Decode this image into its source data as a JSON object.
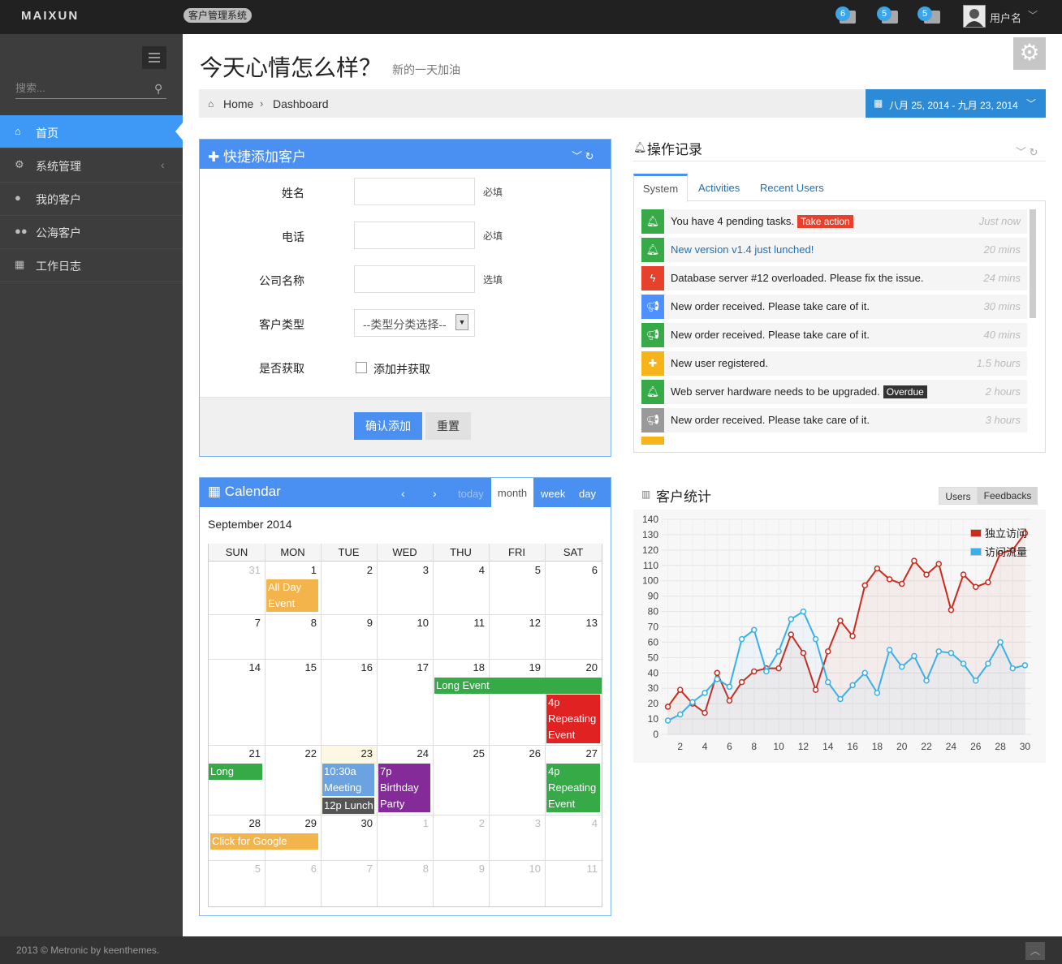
{
  "topbar": {
    "logo": "MAIXUN",
    "system_badge": "客户管理系统",
    "notifications_count": "6",
    "inbox_count": "5",
    "tasks_count": "5",
    "username": "用户名"
  },
  "sidebar": {
    "search_placeholder": "搜索...",
    "items": [
      {
        "label": "首页",
        "icon": "home-icon",
        "active": true
      },
      {
        "label": "系统管理",
        "icon": "cogs-icon"
      },
      {
        "label": "我的客户",
        "icon": "user-icon"
      },
      {
        "label": "公海客户",
        "icon": "group-icon"
      },
      {
        "label": "工作日志",
        "icon": "table-icon"
      }
    ]
  },
  "header": {
    "title": "今天心情怎么样？",
    "subtitle": "新的一天加油",
    "breadcrumb": [
      "Home",
      "Dashboard"
    ],
    "date_range": "八月 25, 2014 - 九月 23, 2014"
  },
  "quick_add": {
    "title": "快捷添加客户",
    "fields": [
      {
        "label": "姓名",
        "hint": "必填"
      },
      {
        "label": "电话",
        "hint": "必填"
      },
      {
        "label": "公司名称",
        "hint": "选填"
      },
      {
        "label": "客户类型",
        "select_value": "--类型分类选择--"
      },
      {
        "label": "是否获取",
        "checkbox_label": "添加并获取"
      }
    ],
    "submit": "确认添加",
    "reset": "重置"
  },
  "activity": {
    "title": "操作记录",
    "tabs": [
      "System",
      "Activities",
      "Recent Users"
    ],
    "feeds": [
      {
        "text": "You have 4 pending tasks.",
        "label": "Take action",
        "label_color": "#e5412d",
        "time": "Just now",
        "color": "#35aa47",
        "icon": "bell-icon",
        "link": false
      },
      {
        "text": "New version v1.4 just lunched!",
        "time": "20 mins",
        "color": "#35aa47",
        "icon": "bell-icon",
        "link": true
      },
      {
        "text": "Database server #12 overloaded. Please fix the issue.",
        "time": "24 mins",
        "color": "#e5412d",
        "icon": "bolt-icon",
        "link": false
      },
      {
        "text": "New order received. Please take care of it.",
        "time": "30 mins",
        "color": "#4d90fe",
        "icon": "bullhorn-icon",
        "link": false
      },
      {
        "text": "New order received. Please take care of it.",
        "time": "40 mins",
        "color": "#35aa47",
        "icon": "bullhorn-icon",
        "link": false
      },
      {
        "text": "New user registered.",
        "time": "1.5 hours",
        "color": "#f4b41a",
        "icon": "plus-icon",
        "link": false
      },
      {
        "text": "Web server hardware needs to be upgraded.",
        "label": "Overdue",
        "label_color": "#333333",
        "time": "2 hours",
        "color": "#35aa47",
        "icon": "bell-icon",
        "link": false
      },
      {
        "text": "New order received. Please take care of it.",
        "time": "3 hours",
        "color": "#999999",
        "icon": "bullhorn-icon",
        "link": false
      }
    ]
  },
  "calendar": {
    "title": "Calendar",
    "buttons": {
      "today": "today",
      "month": "month",
      "week": "week",
      "day": "day"
    },
    "month_title": "September 2014",
    "weekdays": [
      "SUN",
      "MON",
      "TUE",
      "WED",
      "THU",
      "FRI",
      "SAT"
    ],
    "weeks": [
      [
        "31",
        "1",
        "2",
        "3",
        "4",
        "5",
        "6"
      ],
      [
        "7",
        "8",
        "9",
        "10",
        "11",
        "12",
        "13"
      ],
      [
        "14",
        "15",
        "16",
        "17",
        "18",
        "19",
        "20"
      ],
      [
        "21",
        "22",
        "23",
        "24",
        "25",
        "26",
        "27"
      ],
      [
        "28",
        "29",
        "30",
        "1",
        "2",
        "3",
        "4"
      ],
      [
        "5",
        "6",
        "7",
        "8",
        "9",
        "10",
        "11"
      ]
    ],
    "events": [
      {
        "title": "All Day Event",
        "color": "#f4b44c"
      },
      {
        "title": "Long Event",
        "color": "#35aa47"
      },
      {
        "title": "4p Repeating Event",
        "color": "#e02222"
      },
      {
        "title": "Long Event",
        "color": "#35aa47"
      },
      {
        "title": "10:30a Meeting",
        "color": "#6aa3e0"
      },
      {
        "title": "12p Lunch",
        "color": "#555555"
      },
      {
        "title": "7p Birthday Party",
        "color": "#852b99"
      },
      {
        "title": "4p Repeating Event",
        "color": "#35aa47"
      },
      {
        "title": "Click for Google",
        "color": "#f4b44c"
      }
    ]
  },
  "stats": {
    "title": "客户统计",
    "toggle": [
      "Users",
      "Feedbacks"
    ]
  },
  "chart_data": {
    "type": "line",
    "title": "客户统计",
    "x": [
      1,
      2,
      3,
      4,
      5,
      6,
      7,
      8,
      9,
      10,
      11,
      12,
      13,
      14,
      15,
      16,
      17,
      18,
      19,
      20,
      21,
      22,
      23,
      24,
      25,
      26,
      27,
      28,
      29,
      30
    ],
    "xticks": [
      2,
      4,
      6,
      8,
      10,
      12,
      14,
      16,
      18,
      20,
      22,
      24,
      26,
      28,
      30
    ],
    "ylim": [
      0,
      140
    ],
    "yticks": [
      0,
      10,
      20,
      30,
      40,
      50,
      60,
      70,
      80,
      90,
      100,
      110,
      120,
      130,
      140
    ],
    "series": [
      {
        "name": "独立访问",
        "color": "#cb2a1d",
        "values": [
          18,
          29,
          20,
          14,
          40,
          22,
          34,
          41,
          43,
          43,
          65,
          53,
          29,
          54,
          74,
          64,
          97,
          108,
          101,
          98,
          113,
          104,
          111,
          81,
          104,
          96,
          99,
          118,
          120,
          131
        ]
      },
      {
        "name": "访问流量",
        "color": "#3ab0e8",
        "values": [
          9,
          13,
          21,
          27,
          36,
          31,
          62,
          68,
          41,
          54,
          75,
          80,
          62,
          34,
          23,
          32,
          40,
          27,
          55,
          44,
          51,
          35,
          54,
          53,
          46,
          35,
          46,
          60,
          43,
          45
        ]
      }
    ],
    "grid": true,
    "legend": "top-right"
  },
  "footer": {
    "text": "2013 © Metronic by keenthemes."
  }
}
